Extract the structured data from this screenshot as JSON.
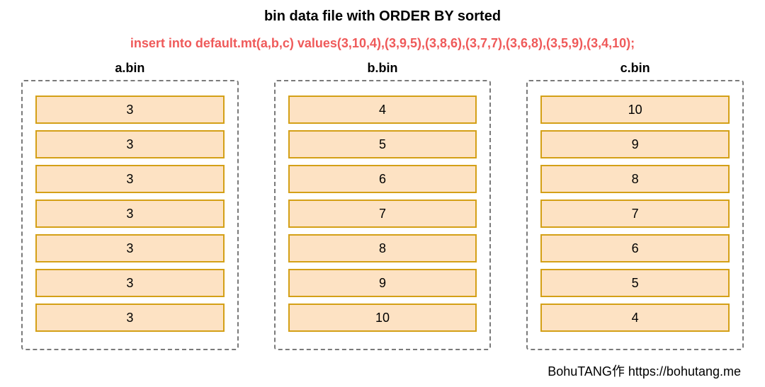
{
  "title": "bin data file with ORDER BY sorted",
  "sql": "insert into default.mt(a,b,c) values(3,10,4),(3,9,5),(3,8,6),(3,7,7),(3,6,8),(3,5,9),(3,4,10);",
  "files": [
    {
      "label": "a.bin",
      "values": [
        "3",
        "3",
        "3",
        "3",
        "3",
        "3",
        "3"
      ]
    },
    {
      "label": "b.bin",
      "values": [
        "4",
        "5",
        "6",
        "7",
        "8",
        "9",
        "10"
      ]
    },
    {
      "label": "c.bin",
      "values": [
        "10",
        "9",
        "8",
        "7",
        "6",
        "5",
        "4"
      ]
    }
  ],
  "credit": "BohuTANG作 https://bohutang.me",
  "colors": {
    "cell_bg": "#fde2c3",
    "cell_border": "#d4a017",
    "sql_text": "#ef5a5a",
    "dashed_border": "#7a7a7a"
  }
}
